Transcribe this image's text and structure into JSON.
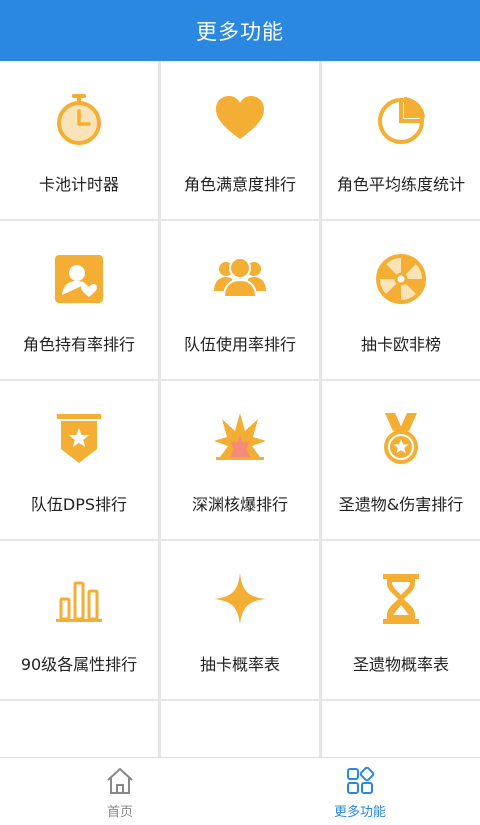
{
  "header": {
    "title": "更多功能"
  },
  "colors": {
    "accent": "#2b88e0",
    "icon": "#f3ae33",
    "active_tab": "#2b88e0",
    "inactive_tab": "#888888"
  },
  "grid": {
    "items": [
      {
        "label": "卡池计时器",
        "icon": "stopwatch-icon"
      },
      {
        "label": "角色满意度排行",
        "icon": "heart-icon"
      },
      {
        "label": "角色平均练度统计",
        "icon": "pie-chart-icon"
      },
      {
        "label": "角色持有率排行",
        "icon": "user-card-icon"
      },
      {
        "label": "队伍使用率排行",
        "icon": "group-icon"
      },
      {
        "label": "抽卡欧非榜",
        "icon": "wheel-icon"
      },
      {
        "label": "队伍DPS排行",
        "icon": "banner-star-icon"
      },
      {
        "label": "深渊核爆排行",
        "icon": "explosion-icon"
      },
      {
        "label": "圣遗物&伤害排行",
        "icon": "medal-icon"
      },
      {
        "label": "90级各属性排行",
        "icon": "bar-chart-icon"
      },
      {
        "label": "抽卡概率表",
        "icon": "sparkle-icon"
      },
      {
        "label": "圣遗物概率表",
        "icon": "hourglass-icon"
      },
      {
        "label": "",
        "icon": "book-icon"
      },
      {
        "label": "",
        "icon": "scroll-icon"
      },
      {
        "label": "",
        "icon": "horned-helmet-icon"
      }
    ]
  },
  "tabbar": {
    "home": {
      "label": "首页",
      "icon": "home-icon"
    },
    "more": {
      "label": "更多功能",
      "icon": "grid-apps-icon"
    }
  }
}
